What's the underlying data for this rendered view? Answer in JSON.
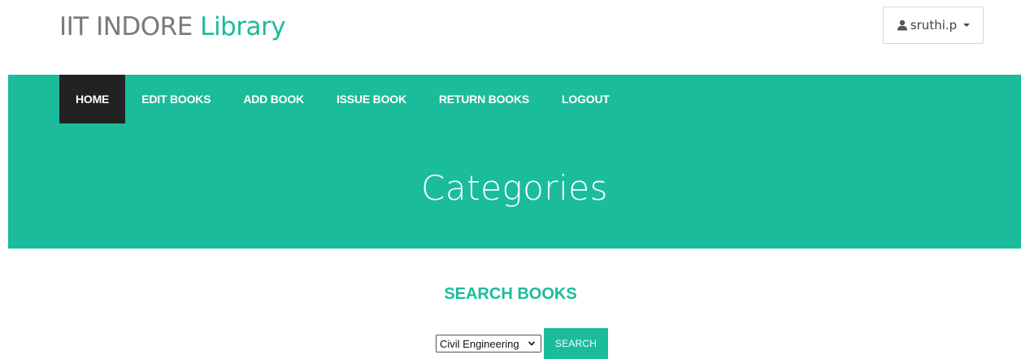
{
  "header": {
    "brand_main": "IIT INDORE",
    "brand_accent": "Library",
    "user_name": "sruthi.p",
    "user_icon": "user-icon"
  },
  "nav": {
    "items": [
      {
        "label": "HOME",
        "active": true
      },
      {
        "label": "EDIT BOOKS",
        "active": false
      },
      {
        "label": "ADD BOOK",
        "active": false
      },
      {
        "label": "ISSUE BOOK",
        "active": false
      },
      {
        "label": "RETURN BOOKS",
        "active": false
      },
      {
        "label": "LOGOUT",
        "active": false
      }
    ]
  },
  "banner": {
    "title": "Categories"
  },
  "search": {
    "heading": "SEARCH BOOKS",
    "selected_category": "Civil Engineering",
    "button_label": "SEARCH"
  },
  "colors": {
    "accent": "#1bbc9b",
    "nav_active_bg": "#222222",
    "brand_text": "#7a7a7a"
  }
}
